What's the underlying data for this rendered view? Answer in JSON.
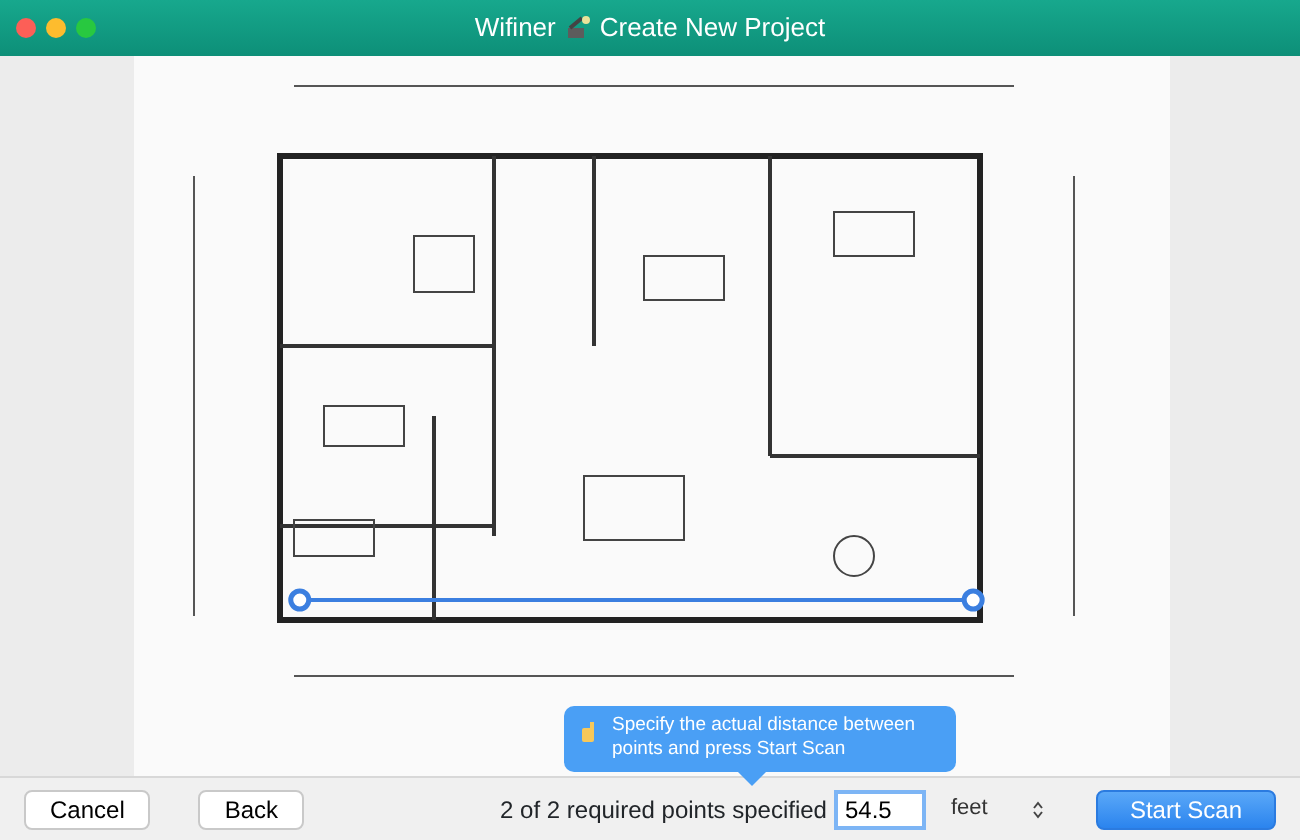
{
  "window": {
    "title_parts": [
      "Wifiner",
      "Create New Project"
    ]
  },
  "tooltip": {
    "text": "Specify the actual distance between points and press Start Scan"
  },
  "footer": {
    "cancel": "Cancel",
    "back": "Back",
    "status": "2 of 2 required points specified",
    "distance": {
      "value": "54.5"
    },
    "unit": "feet",
    "start": "Start Scan"
  }
}
